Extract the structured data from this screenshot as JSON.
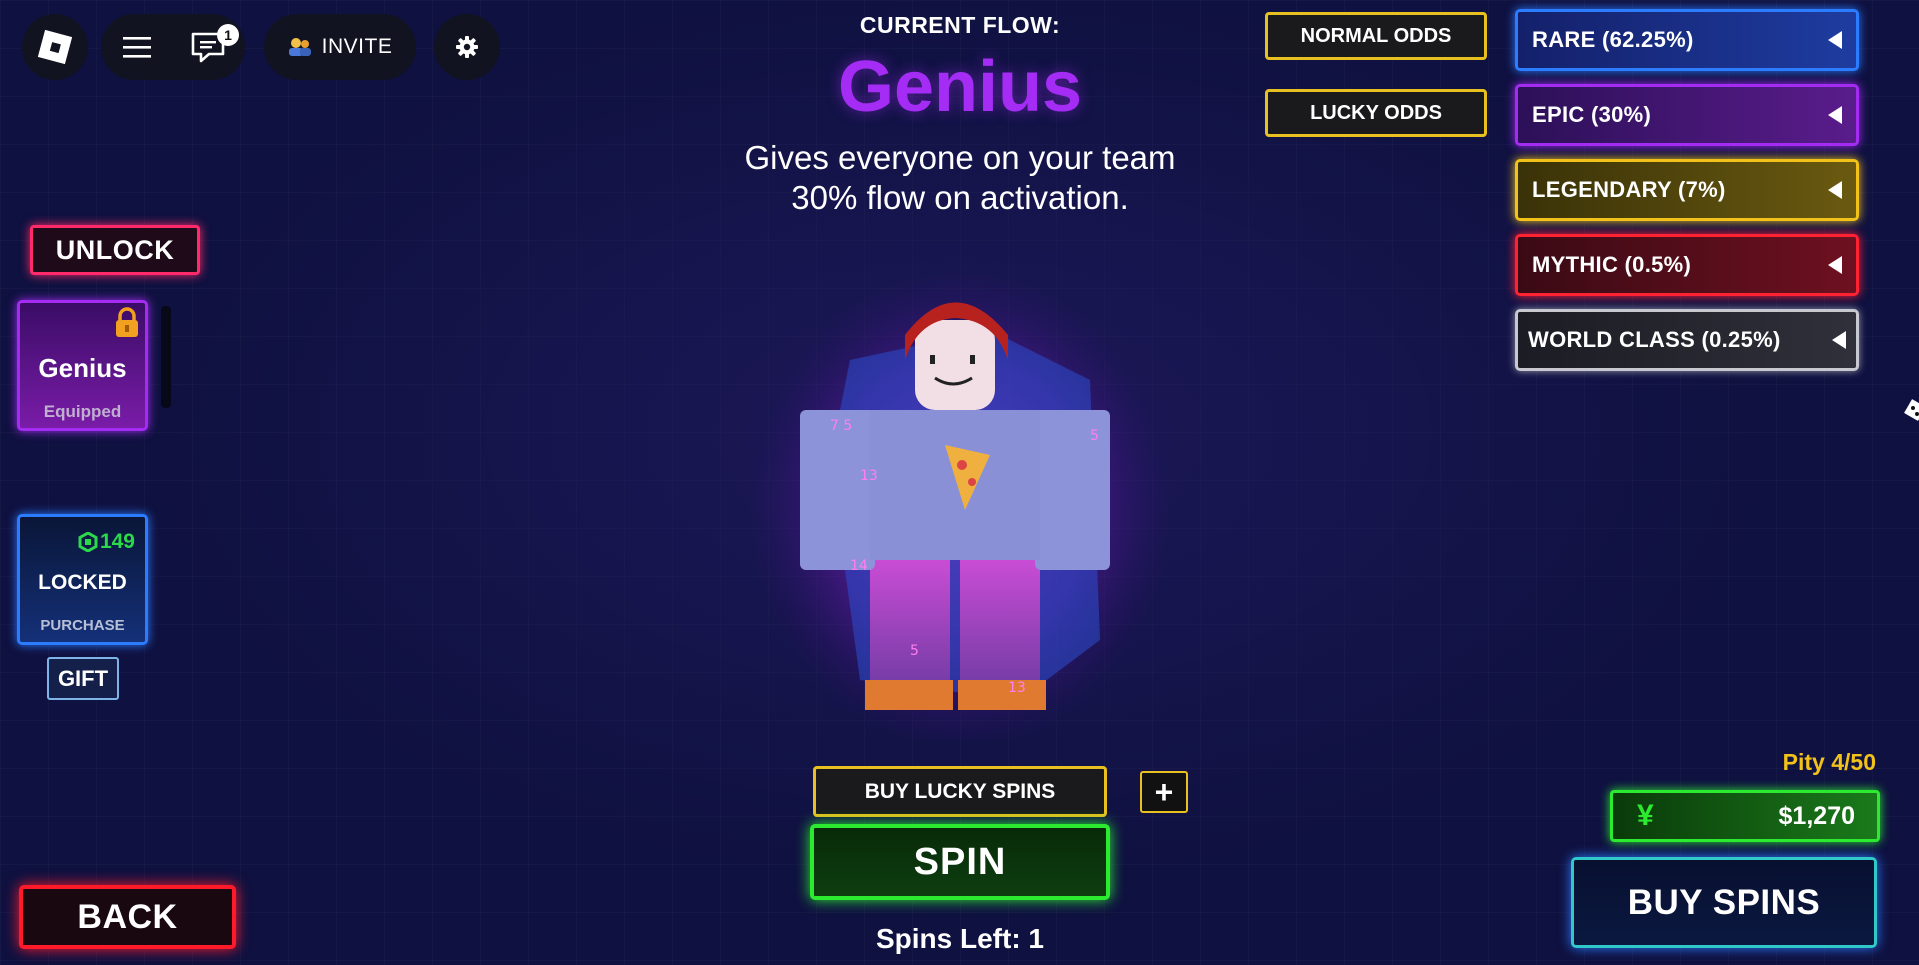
{
  "topbar": {
    "chat_badge": "1",
    "invite_label": "INVITE"
  },
  "flow": {
    "heading": "CURRENT FLOW:",
    "name": "Genius",
    "desc_line1": "Gives everyone on your team",
    "desc_line2": "30% flow on activation.",
    "name_color": "#a52cf5"
  },
  "odds_mode": {
    "normal": "NORMAL ODDS",
    "lucky": "LUCKY ODDS"
  },
  "odds": [
    {
      "label": "RARE (62.25%)",
      "color": "#2b7cff"
    },
    {
      "label": "EPIC (30%)",
      "color": "#a42cf2"
    },
    {
      "label": "LEGENDARY (7%)",
      "color": "#f2c21a"
    },
    {
      "label": "MYTHIC (0.5%)",
      "color": "#ff2233"
    },
    {
      "label": "WORLD CLASS (0.25%)",
      "color": "#c8c8d0"
    }
  ],
  "left": {
    "unlock_label": "UNLOCK",
    "slot1": {
      "name": "Genius",
      "status": "Equipped"
    },
    "slot2": {
      "price": "149",
      "state": "LOCKED",
      "action": "PURCHASE"
    },
    "gift_label": "GIFT",
    "back_label": "BACK"
  },
  "bottom": {
    "buy_lucky_label": "BUY LUCKY SPINS",
    "plus_label": "+",
    "spin_label": "SPIN",
    "spins_left": "Spins Left: 1"
  },
  "right_bottom": {
    "pity": "Pity 4/50",
    "currency_symbol": "¥",
    "money": "$1,270",
    "buy_spins_label": "BUY SPINS"
  }
}
